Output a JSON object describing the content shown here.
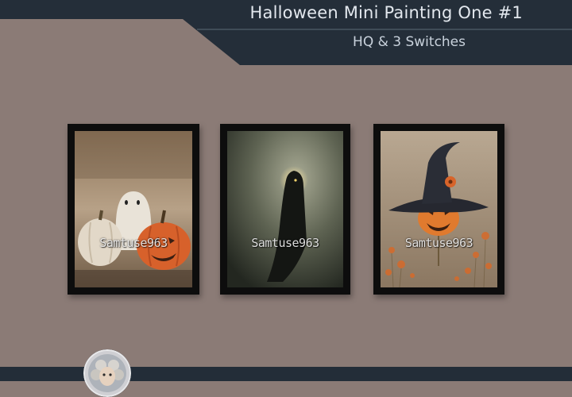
{
  "header": {
    "title": "Halloween Mini Painting One #1",
    "subtitle": "HQ & 3 Switches"
  },
  "paintings": [
    {
      "subject": "ghost-and-pumpkins",
      "watermark": "Samtuse963"
    },
    {
      "subject": "hooded-shadow-figure",
      "watermark": "Samtuse963"
    },
    {
      "subject": "pumpkin-witch-hat",
      "watermark": "Samtuse963"
    }
  ],
  "colors": {
    "background": "#8b7b76",
    "header": "#232d38",
    "frame": "#0d0d0d"
  }
}
